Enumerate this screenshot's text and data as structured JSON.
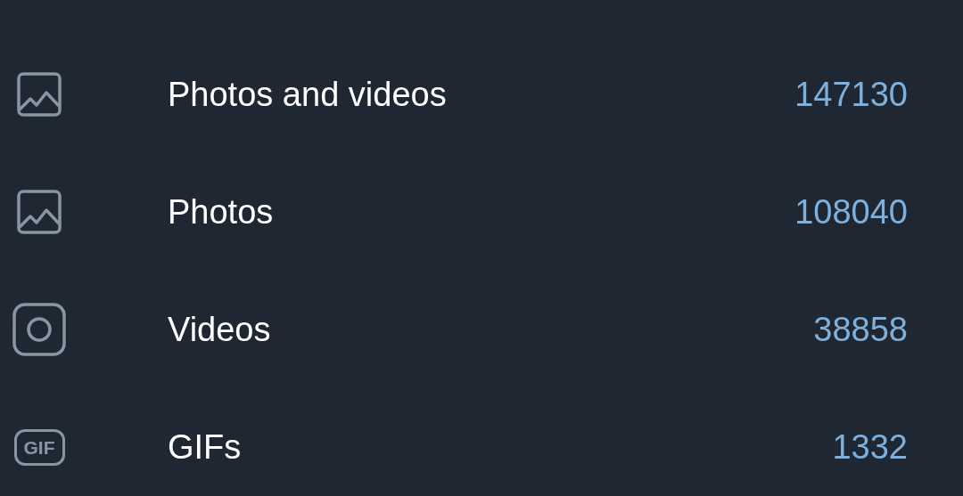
{
  "items": [
    {
      "kind": "image",
      "label": "Photos and videos",
      "count": "147130"
    },
    {
      "kind": "image",
      "label": "Photos",
      "count": "108040"
    },
    {
      "kind": "video",
      "label": "Videos",
      "count": "38858"
    },
    {
      "kind": "gif",
      "icon_text": "GIF",
      "label": "GIFs",
      "count": "1332"
    }
  ]
}
